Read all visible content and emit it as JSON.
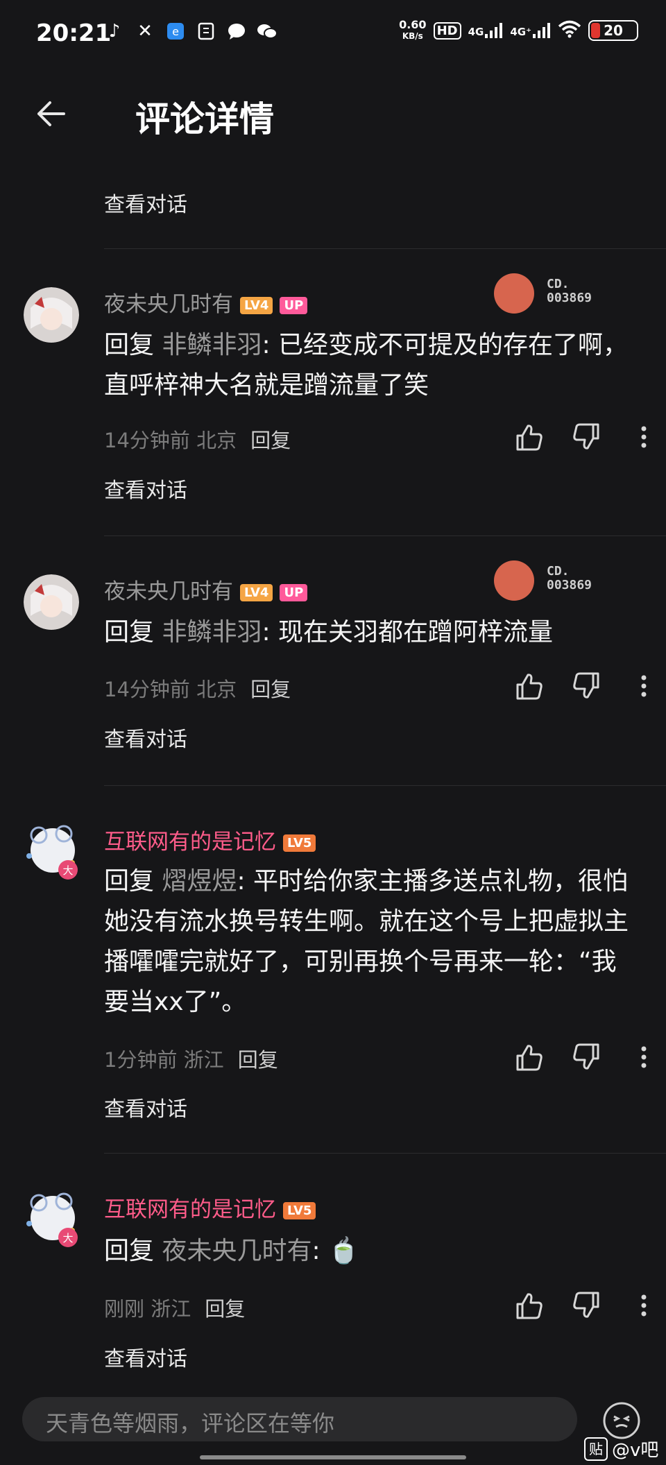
{
  "status_bar": {
    "time": "20:21",
    "speed_value": "0.60",
    "speed_unit": "KB/s",
    "hd": "HD",
    "net1": "4G",
    "net2": "4G⁺",
    "battery": "20",
    "battery_color": "#e0362f",
    "app_icons": [
      "tiktok-icon",
      "x-icon",
      "app-icon",
      "document-icon",
      "chat-icon",
      "wechat-icon"
    ]
  },
  "header": {
    "title": "评论详情"
  },
  "top_link": "查看对话",
  "comments": [
    {
      "user": "夜未央几时有",
      "level": "LV4",
      "up_badge": "UP",
      "fan_badge": {
        "line1": "CD.",
        "line2": "003869"
      },
      "reply_prefix": "回复",
      "reply_to": "非鳞非羽",
      "text": ": 已经变成不可提及的存在了啊，直呼梓神大名就是蹭流量了笑",
      "time": "14分钟前",
      "location": "北京",
      "reply_btn": "回复",
      "view_conv": "查看对话"
    },
    {
      "user": "夜未央几时有",
      "level": "LV4",
      "up_badge": "UP",
      "fan_badge": {
        "line1": "CD.",
        "line2": "003869"
      },
      "reply_prefix": "回复",
      "reply_to": "非鳞非羽",
      "text": ": 现在关羽都在蹭阿梓流量",
      "time": "14分钟前",
      "location": "北京",
      "reply_btn": "回复",
      "view_conv": "查看对话"
    },
    {
      "user": "互联网有的是记忆",
      "level": "LV5",
      "reply_prefix": "回复",
      "reply_to": "熠煜煜",
      "text": ": 平时给你家主播多送点礼物，很怕她没有流水换号转生啊。就在这个号上把虚拟主播嚯嚯完就好了，可别再换个号再来一轮：“我要当xx了”。",
      "time": "1分钟前",
      "location": "浙江",
      "reply_btn": "回复",
      "view_conv": "查看对话"
    },
    {
      "user": "互联网有的是记忆",
      "level": "LV5",
      "reply_prefix": "回复",
      "reply_to": "夜未央几时有",
      "text": ": 🍵",
      "time": "刚刚",
      "location": "浙江",
      "reply_btn": "回复",
      "view_conv": "查看对话"
    }
  ],
  "colors": {
    "username_default": "#9a9a9a",
    "username_vip": "#ff5c8a",
    "background": "#161618"
  },
  "input": {
    "placeholder": "天青色等烟雨，评论区在等你"
  },
  "watermark": "@v吧",
  "watermark_badge": "贴"
}
